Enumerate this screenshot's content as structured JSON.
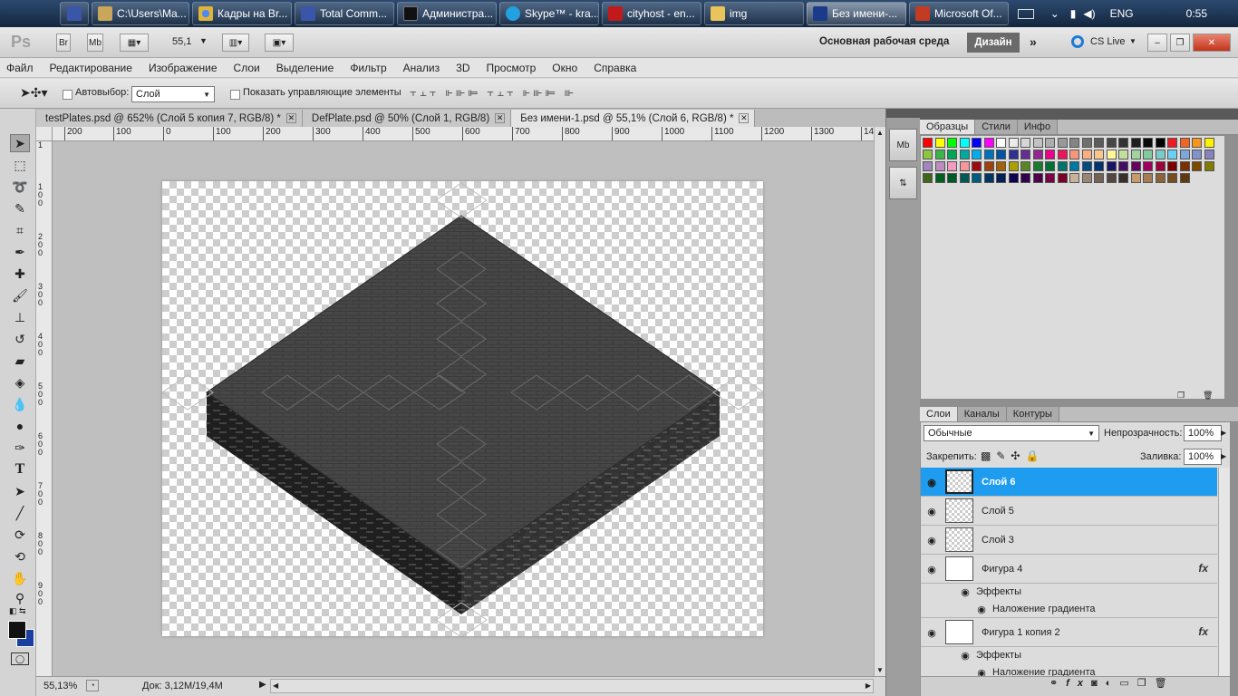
{
  "taskbar": {
    "items": [
      {
        "label": "",
        "icon": "save-icon",
        "color": "#3a56a8"
      },
      {
        "label": "C:\\Users\\Ma...",
        "icon": "explorer-window-icon",
        "color": "#c9a65a"
      },
      {
        "label": "Кадры на Br...",
        "icon": "chrome-icon",
        "color": "#e0b43a"
      },
      {
        "label": "Total Comm...",
        "icon": "total-commander-icon",
        "color": "#3a56a8"
      },
      {
        "label": "Администра...",
        "icon": "command-prompt-icon",
        "color": "#111111"
      },
      {
        "label": "Skype™ - kra...",
        "icon": "skype-icon",
        "color": "#22a0e0"
      },
      {
        "label": "cityhost - en...",
        "icon": "filezilla-icon",
        "color": "#c01a1a"
      },
      {
        "label": "img",
        "icon": "folder-icon",
        "color": "#e8c45a"
      },
      {
        "label": "Без имени-...",
        "icon": "photoshop-icon",
        "color": "#1c3a8a"
      },
      {
        "label": "Microsoft Of...",
        "icon": "office-icon",
        "color": "#c23b22"
      }
    ],
    "tray": {
      "lang": "ENG",
      "time": "0:55"
    }
  },
  "appbar": {
    "logo": "Ps",
    "br": "Br",
    "mb": "Mb",
    "zoom": "55,1",
    "workspace": "Основная рабочая среда",
    "design": "Дизайн",
    "cslive": "CS Live"
  },
  "menu": [
    "Файл",
    "Редактирование",
    "Изображение",
    "Слои",
    "Выделение",
    "Фильтр",
    "Анализ",
    "3D",
    "Просмотр",
    "Окно",
    "Справка"
  ],
  "options": {
    "autoselect_label": "Автовыбор:",
    "autoselect_value": "Слой",
    "show_controls": "Показать управляющие элементы"
  },
  "tabs": [
    {
      "label": "testPlates.psd @ 652% (Слой 5 копия 7, RGB/8) *",
      "active": false
    },
    {
      "label": "DefPlate.psd @ 50% (Слой 1, RGB/8)",
      "active": false
    },
    {
      "label": "Без имени-1.psd @ 55,1% (Слой 6, RGB/8) *",
      "active": true
    }
  ],
  "ruler_h": [
    "200",
    "100",
    "0",
    "100",
    "200",
    "300",
    "400",
    "500",
    "600",
    "700",
    "800",
    "900",
    "1000",
    "1100",
    "1200",
    "1300",
    "14"
  ],
  "ruler_v": [
    "1",
    "1\n0\n0",
    "2\n0\n0",
    "3\n0\n0",
    "4\n0\n0",
    "5\n0\n0",
    "6\n0\n0",
    "7\n0\n0",
    "8\n0\n0",
    "9\n0\n0"
  ],
  "status": {
    "zoom": "55,13%",
    "doc": "Док: 3,12M/19,4M"
  },
  "swatch_panel": {
    "tabs": [
      "Образцы",
      "Стили",
      "Инфо"
    ]
  },
  "layers_panel": {
    "tabs": [
      "Слои",
      "Каналы",
      "Контуры"
    ],
    "blend_mode": "Обычные",
    "opacity_label": "Непрозрачность:",
    "opacity": "100%",
    "lock_label": "Закрепить:",
    "fill_label": "Заливка:",
    "fill": "100%",
    "layers": [
      {
        "name": "Слой 6",
        "selected": true,
        "fx": ""
      },
      {
        "name": "Слой 5",
        "selected": false,
        "fx": ""
      },
      {
        "name": "Слой 3",
        "selected": false,
        "fx": ""
      },
      {
        "name": "Фигура 4",
        "selected": false,
        "fx": "fx"
      },
      {
        "name": "Эффекты",
        "sub": true
      },
      {
        "name": "Наложение градиента",
        "sub2": true
      },
      {
        "name": "Фигура 1 копия 2",
        "selected": false,
        "fx": "fx"
      },
      {
        "name": "Эффекты",
        "sub": true
      },
      {
        "name": "Наложение градиента",
        "sub2": true
      }
    ]
  },
  "colors": {
    "selected_layer": "#1e9cf0",
    "foreground": "#111111",
    "background": "#1b3fa0"
  }
}
